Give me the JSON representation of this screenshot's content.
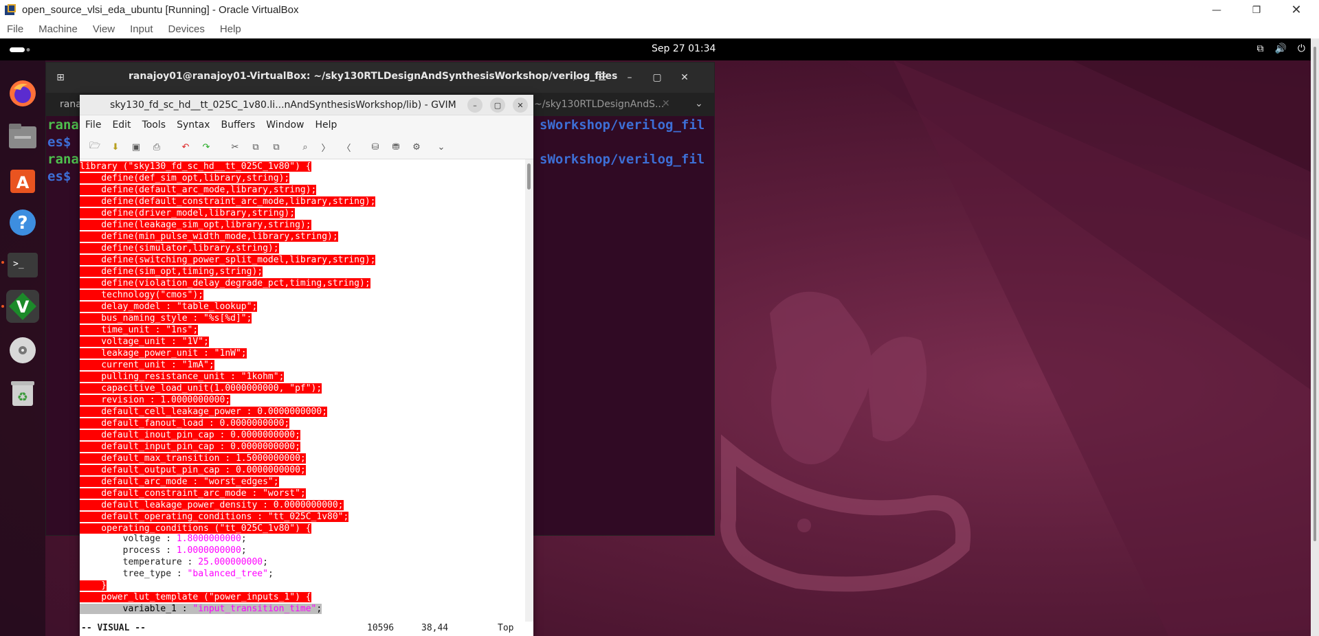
{
  "host": {
    "title": "open_source_vlsi_eda_ubuntu [Running] - Oracle VirtualBox",
    "menu": [
      "File",
      "Machine",
      "View",
      "Input",
      "Devices",
      "Help"
    ]
  },
  "gnome": {
    "clock": "Sep 27  01:34"
  },
  "dock": {
    "items": [
      "firefox-icon",
      "files-icon",
      "app-center-icon",
      "help-icon",
      "terminal-icon",
      "gvim-icon",
      "dvd-icon",
      "trash-icon"
    ]
  },
  "terminal": {
    "title": "ranajoy01@ranajoy01-VirtualBox: ~/sky130RTLDesignAndSynthesisWorkshop/verilog_files",
    "tab1": "rana",
    "tab2": "~/sky130RTLDesignAndS...",
    "lines": [
      {
        "a": "rana",
        "b": "sWorkshop/verilog_fil"
      },
      {
        "a": "es$",
        "b": ""
      },
      {
        "a": "rana",
        "b": "sWorkshop/verilog_fil"
      },
      {
        "a": "es$",
        "b": ""
      }
    ]
  },
  "gvim": {
    "title": "sky130_fd_sc_hd__tt_025C_1v80.li...nAndSynthesisWorkshop/lib) - GVIM",
    "menu": [
      "File",
      "Edit",
      "Tools",
      "Syntax",
      "Buffers",
      "Window",
      "Help"
    ],
    "selected_lines": [
      "library (\"sky130_fd_sc_hd__tt_025C_1v80\") {",
      "    define(def_sim_opt,library,string);",
      "    define(default_arc_mode,library,string);",
      "    define(default_constraint_arc_mode,library,string);",
      "    define(driver_model,library,string);",
      "    define(leakage_sim_opt,library,string);",
      "    define(min_pulse_width_mode,library,string);",
      "    define(simulator,library,string);",
      "    define(switching_power_split_model,library,string);",
      "    define(sim_opt,timing,string);",
      "    define(violation_delay_degrade_pct,timing,string);",
      "    technology(\"cmos\");",
      "    delay_model : \"table_lookup\";",
      "    bus_naming_style : \"%s[%d]\";",
      "    time_unit : \"1ns\";",
      "    voltage_unit : \"1V\";",
      "    leakage_power_unit : \"1nW\";",
      "    current_unit : \"1mA\";",
      "    pulling_resistance_unit : \"1kohm\";",
      "    capacitive_load_unit(1.0000000000, \"pf\");",
      "    revision : 1.0000000000;",
      "    default_cell_leakage_power : 0.0000000000;",
      "    default_fanout_load : 0.0000000000;",
      "    default_inout_pin_cap : 0.0000000000;",
      "    default_input_pin_cap : 0.0000000000;",
      "    default_max_transition : 1.5000000000;",
      "    default_output_pin_cap : 0.0000000000;",
      "    default_arc_mode : \"worst_edges\";",
      "    default_constraint_arc_mode : \"worst\";",
      "    default_leakage_power_density : 0.0000000000;",
      "    default_operating_conditions : \"tt_025C_1v80\";",
      "    operating_conditions (\"tt_025C_1v80\") {"
    ],
    "oc_lines": [
      {
        "k": "        voltage : ",
        "v": "1.8000000000",
        "e": ";"
      },
      {
        "k": "        process : ",
        "v": "1.0000000000",
        "e": ";"
      },
      {
        "k": "        temperature : ",
        "v": "25.000000000",
        "e": ";"
      },
      {
        "k": "        tree_type : ",
        "v": "\"balanced_tree\"",
        "e": ";"
      }
    ],
    "close_brace": "    }",
    "plt_line": "    power_lut_template (\"power_inputs_1\") {",
    "var_key": "        variable_1 : ",
    "var_val": "\"input_transition_time\"",
    "var_end": ";",
    "status": {
      "mode": "-- VISUAL --",
      "count": "10596",
      "pos": "38,44",
      "scroll": "Top"
    }
  }
}
